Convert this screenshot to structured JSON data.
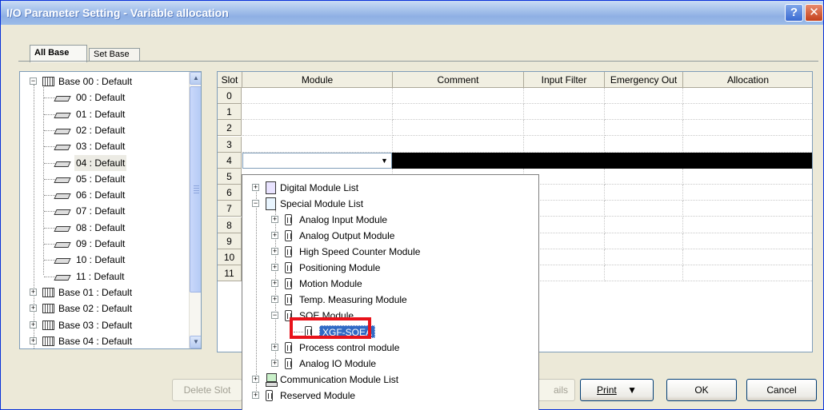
{
  "window": {
    "title": "I/O Parameter Setting - Variable allocation",
    "help_label": "?",
    "close_label": "✕"
  },
  "tabs": [
    {
      "label": "All Base",
      "active": true
    },
    {
      "label": "Set Base",
      "active": false
    }
  ],
  "tree": {
    "items": [
      {
        "label": "Base 00 : Default",
        "level": 0,
        "expander": "−"
      },
      {
        "label": "00 : Default",
        "level": 1
      },
      {
        "label": "01 : Default",
        "level": 1
      },
      {
        "label": "02 : Default",
        "level": 1
      },
      {
        "label": "03 : Default",
        "level": 1
      },
      {
        "label": "04 : Default",
        "level": 1,
        "selected": true
      },
      {
        "label": "05 : Default",
        "level": 1
      },
      {
        "label": "06 : Default",
        "level": 1
      },
      {
        "label": "07 : Default",
        "level": 1
      },
      {
        "label": "08 : Default",
        "level": 1
      },
      {
        "label": "09 : Default",
        "level": 1
      },
      {
        "label": "10 : Default",
        "level": 1
      },
      {
        "label": "11 : Default",
        "level": 1
      },
      {
        "label": "Base 01 : Default",
        "level": 0,
        "expander": "+"
      },
      {
        "label": "Base 02 : Default",
        "level": 0,
        "expander": "+"
      },
      {
        "label": "Base 03 : Default",
        "level": 0,
        "expander": "+"
      },
      {
        "label": "Base 04 : Default",
        "level": 0,
        "expander": "+"
      }
    ]
  },
  "grid": {
    "columns": [
      "Slot",
      "Module",
      "Comment",
      "Input Filter",
      "Emergency Out",
      "Allocation"
    ],
    "slots": [
      "0",
      "1",
      "2",
      "3",
      "4",
      "5",
      "6",
      "7",
      "8",
      "9",
      "10",
      "11"
    ],
    "selected_slot": "4",
    "combo_arrow": "▼"
  },
  "popup": {
    "items": [
      {
        "label": "Digital Module List",
        "level": 0,
        "expander": "+",
        "icon": "list-icon"
      },
      {
        "label": "Special Module List",
        "level": 0,
        "expander": "−",
        "icon": "list-icon"
      },
      {
        "label": "Analog Input Module",
        "level": 1,
        "expander": "+",
        "icon": "module-icon"
      },
      {
        "label": "Analog Output Module",
        "level": 1,
        "expander": "+",
        "icon": "module-icon"
      },
      {
        "label": "High Speed Counter Module",
        "level": 1,
        "expander": "+",
        "icon": "module-icon"
      },
      {
        "label": "Positioning Module",
        "level": 1,
        "expander": "+",
        "icon": "module-icon"
      },
      {
        "label": "Motion Module",
        "level": 1,
        "expander": "+",
        "icon": "module-icon"
      },
      {
        "label": "Temp. Measuring Module",
        "level": 1,
        "expander": "+",
        "icon": "module-icon"
      },
      {
        "label": "SOE Module",
        "level": 1,
        "expander": "−",
        "icon": "module-icon"
      },
      {
        "label": "XGF-SOEA",
        "level": 2,
        "icon": "module-icon",
        "selected": true
      },
      {
        "label": "Process control module",
        "level": 1,
        "expander": "+",
        "icon": "module-icon"
      },
      {
        "label": "Analog IO Module",
        "level": 1,
        "expander": "+",
        "icon": "module-icon"
      },
      {
        "label": "Communication Module List",
        "level": 0,
        "expander": "+",
        "icon": "pc-icon"
      },
      {
        "label": "Reserved Module",
        "level": 0,
        "expander": "+",
        "icon": "module-icon"
      }
    ]
  },
  "buttons": {
    "delete_slot": "Delete Slot",
    "details_partial": "ails",
    "print": "Print",
    "print_arrow": "▼",
    "ok": "OK",
    "cancel": "Cancel"
  },
  "colors": {
    "selection": "#316ac5",
    "highlight_box": "#e8121a",
    "title_gradient_end": "#8fb0e4"
  }
}
